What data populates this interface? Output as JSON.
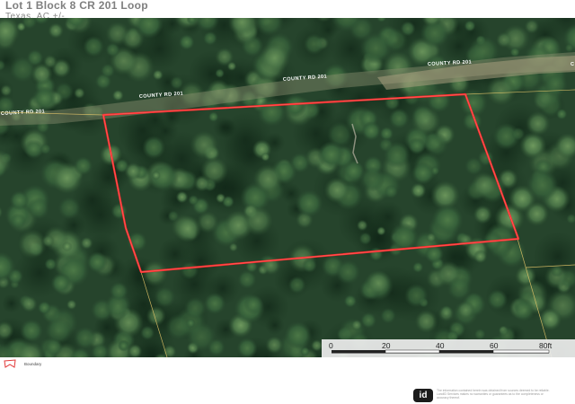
{
  "header": {
    "title": "Lot 1 Block 8 CR 201 Loop",
    "subtitle": "Texas,  AC +/-"
  },
  "map": {
    "road_labels": [
      "COUNTY RD 201",
      "COUNTY RD 201",
      "COUNTY RD 201",
      "COUNTY RD 201"
    ],
    "boundary_color": "#ff2a2a",
    "parcel_line_color": "#e8c86a",
    "scale_bar": {
      "ticks": [
        "0",
        "20",
        "40",
        "60",
        "80ft"
      ]
    }
  },
  "legend": {
    "label": "Boundary",
    "icon": "boundary-swatch-icon"
  },
  "footer": {
    "logo_text": "id",
    "disclaimer": "The information contained herein was obtained from sources deemed to be reliable. LandID Services makes no warranties or guarantees as to the completeness or accuracy thereof."
  }
}
